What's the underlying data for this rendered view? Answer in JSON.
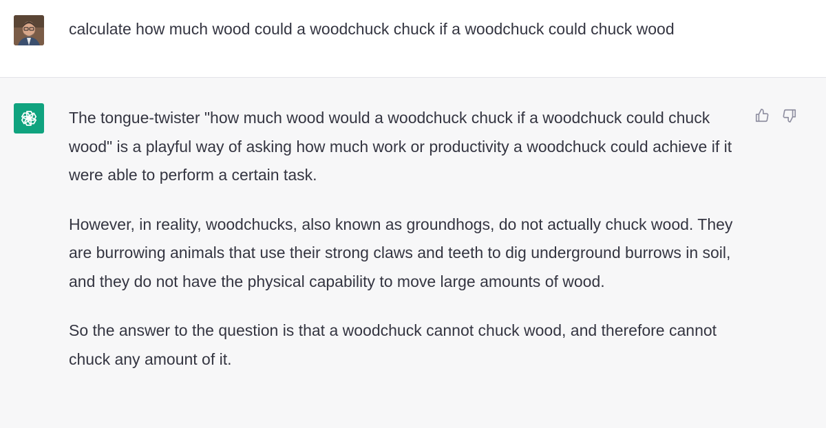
{
  "user_message": {
    "text": "calculate how much wood could a woodchuck chuck if a woodchuck could chuck wood"
  },
  "assistant_message": {
    "paragraphs": [
      "The tongue-twister \"how much wood would a woodchuck chuck if a woodchuck could chuck wood\" is a playful way of asking how much work or productivity a woodchuck could achieve if it were able to perform a certain task.",
      "However, in reality, woodchucks, also known as groundhogs, do not actually chuck wood. They are burrowing animals that use their strong claws and teeth to dig underground burrows in soil, and they do not have the physical capability to move large amounts of wood.",
      "So the answer to the question is that a woodchuck cannot chuck wood, and therefore cannot chuck any amount of it."
    ]
  },
  "icons": {
    "user_avatar": "user-avatar-photo",
    "assistant_avatar": "openai-logo-icon",
    "thumbs_up": "thumbs-up-icon",
    "thumbs_down": "thumbs-down-icon"
  },
  "colors": {
    "assistant_bg": "#f7f7f8",
    "user_bg": "#ffffff",
    "brand_green": "#10a37f",
    "text": "#343541",
    "icon_gray": "#8e8ea0"
  }
}
